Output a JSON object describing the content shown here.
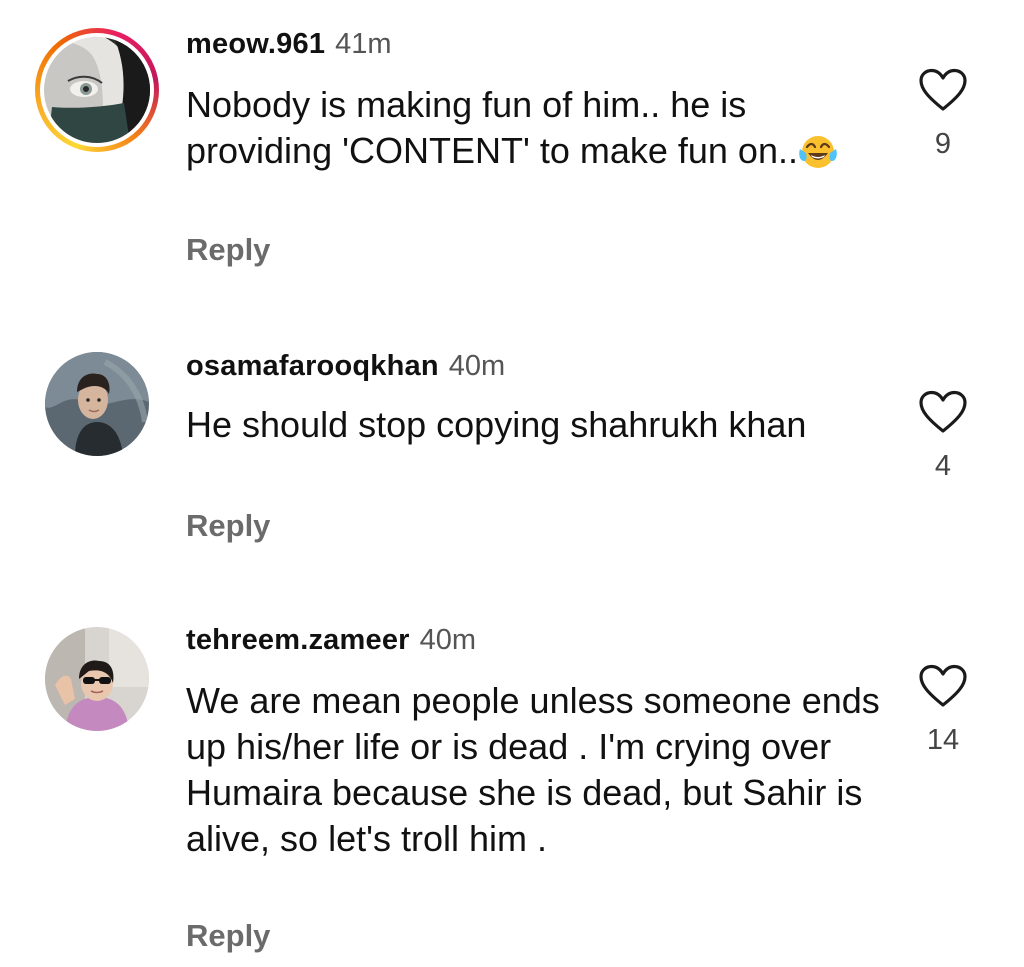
{
  "comments": [
    {
      "username": "meow.961",
      "time": "41m",
      "text": "Nobody is making fun of him.. he is providing 'CONTENT' to make fun on..",
      "emoji": "face-with-tears-of-joy",
      "reply_label": "Reply",
      "likes": "9",
      "has_story_ring": true
    },
    {
      "username": "osamafarooqkhan",
      "time": "40m",
      "text": "He should stop copying shahrukh khan",
      "reply_label": "Reply",
      "likes": "4",
      "has_story_ring": false
    },
    {
      "username": "tehreem.zameer",
      "time": "40m",
      "text": "We are mean people unless someone ends up his/her life or is dead .  I'm crying over Humaira because she is dead, but Sahir is alive, so let's troll him .",
      "reply_label": "Reply",
      "likes": "14",
      "has_story_ring": false
    }
  ],
  "icons": {
    "like": "heart-outline-icon"
  },
  "colors": {
    "background": "#ffffff",
    "text": "#111111",
    "secondary": "#6b6b6b"
  }
}
